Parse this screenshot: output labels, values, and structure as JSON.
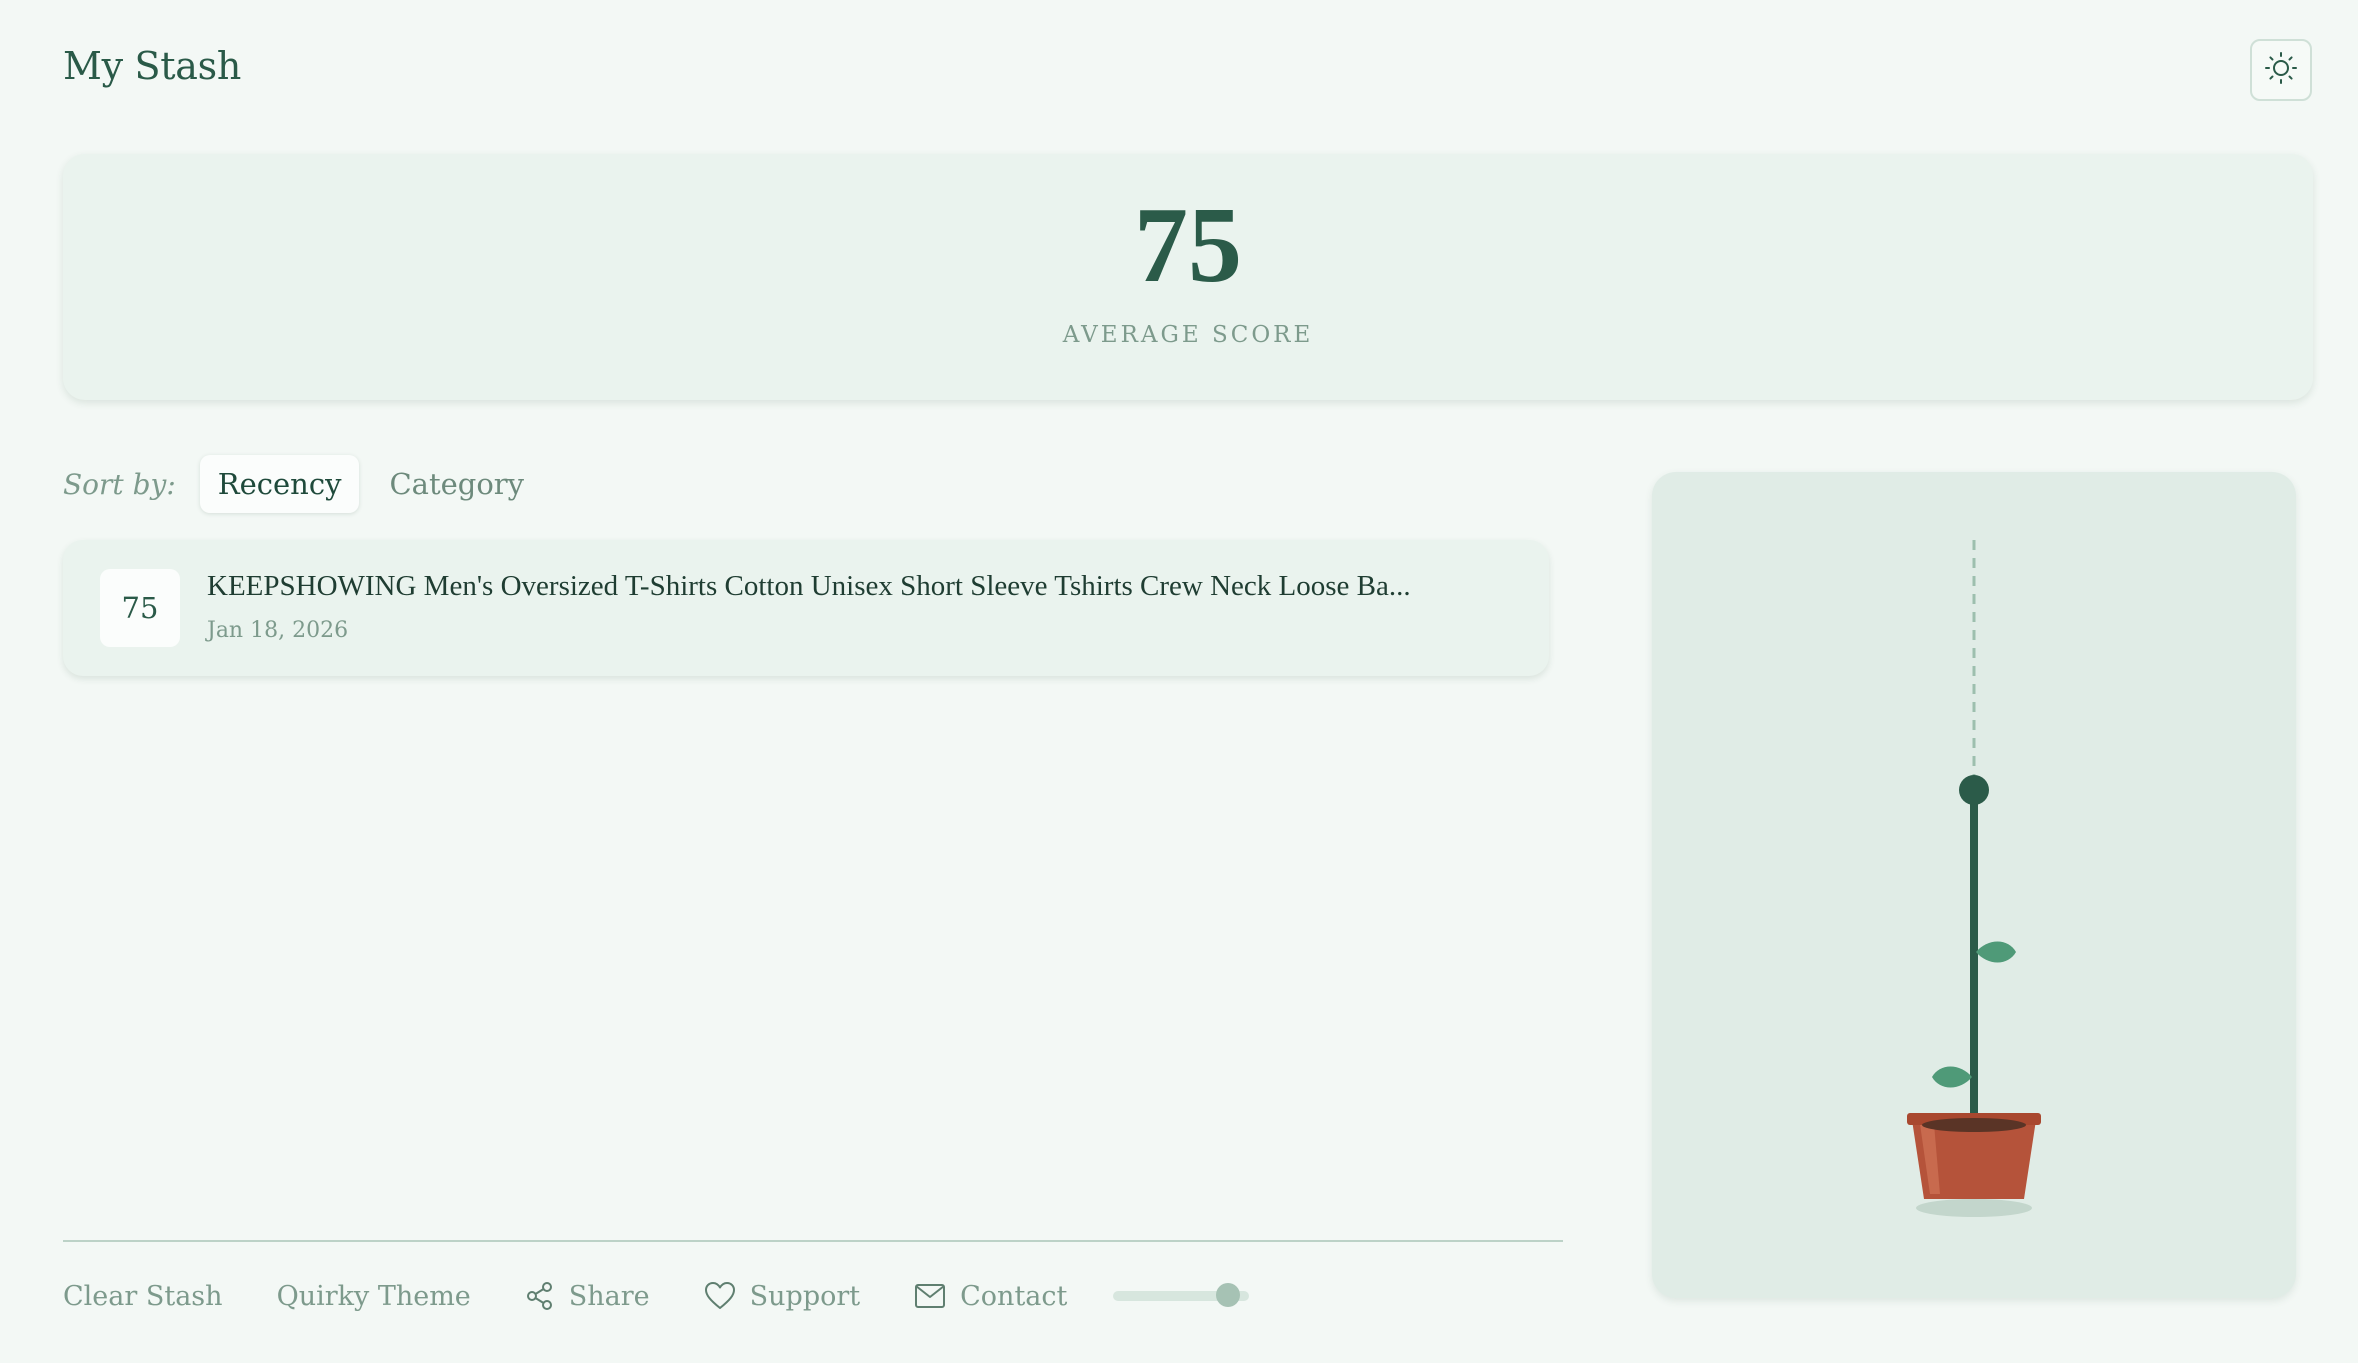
{
  "header": {
    "title": "My Stash",
    "theme_toggle_icon": "sun-icon"
  },
  "summary": {
    "score": "75",
    "label": "AVERAGE SCORE"
  },
  "sort": {
    "label": "Sort by:",
    "options": [
      "Recency",
      "Category"
    ],
    "selected": "Recency"
  },
  "items": [
    {
      "score": "75",
      "title": "KEEPSHOWING Men's Oversized T-Shirts Cotton Unisex Short Sleeve Tshirts Crew Neck Loose Ba...",
      "date": "Jan 18, 2026"
    }
  ],
  "footer": {
    "clear": "Clear Stash",
    "theme": "Quirky Theme",
    "share": "Share",
    "support": "Support",
    "contact": "Contact",
    "slider_value": 0.84
  },
  "colors": {
    "accent": "#2b5b49",
    "leaf": "#4f9a78",
    "pot": "#b5533a",
    "background": "#f3f8f5"
  }
}
